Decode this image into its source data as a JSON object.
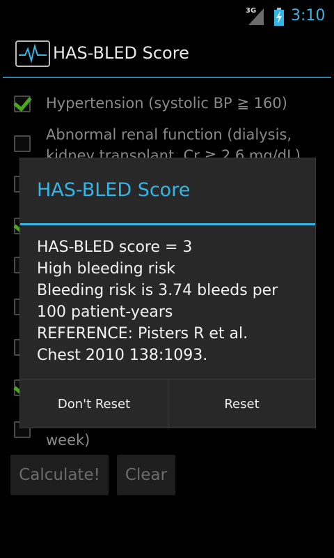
{
  "status_bar": {
    "network": "3G",
    "time": "3:10"
  },
  "app_bar": {
    "title": "HAS-BLED Score",
    "icon": "heart-monitor-icon"
  },
  "checklist": [
    {
      "label": "Hypertension (systolic BP ≧ 160)",
      "checked": true
    },
    {
      "label": "Abnormal renal function (dialysis,",
      "label2": "kidney transplant, Cr ≧ 2.6 mg/dL)",
      "checked": false
    },
    {
      "label": "",
      "checked": false
    },
    {
      "label": "",
      "checked": true
    },
    {
      "label": "",
      "checked": false
    },
    {
      "label": "",
      "checked": false
    },
    {
      "label": "",
      "checked": false
    },
    {
      "label": "",
      "checked": true
    },
    {
      "label": "",
      "label2": "week)",
      "checked": false
    }
  ],
  "buttons": {
    "calculate": "Calculate!",
    "clear": "Clear"
  },
  "dialog": {
    "title": "HAS-BLED Score",
    "message_lines": [
      "HAS-BLED score = 3",
      "High bleeding risk",
      "Bleeding risk is 3.74 bleeds per",
      "100 patient-years",
      "REFERENCE: Pisters R et al.",
      "Chest 2010 138:1093."
    ],
    "negative_button": "Don't Reset",
    "positive_button": "Reset"
  },
  "colors": {
    "accent": "#33b5e5",
    "check": "#4aa81b",
    "background": "#000000",
    "dialog_bg": "#282828"
  }
}
